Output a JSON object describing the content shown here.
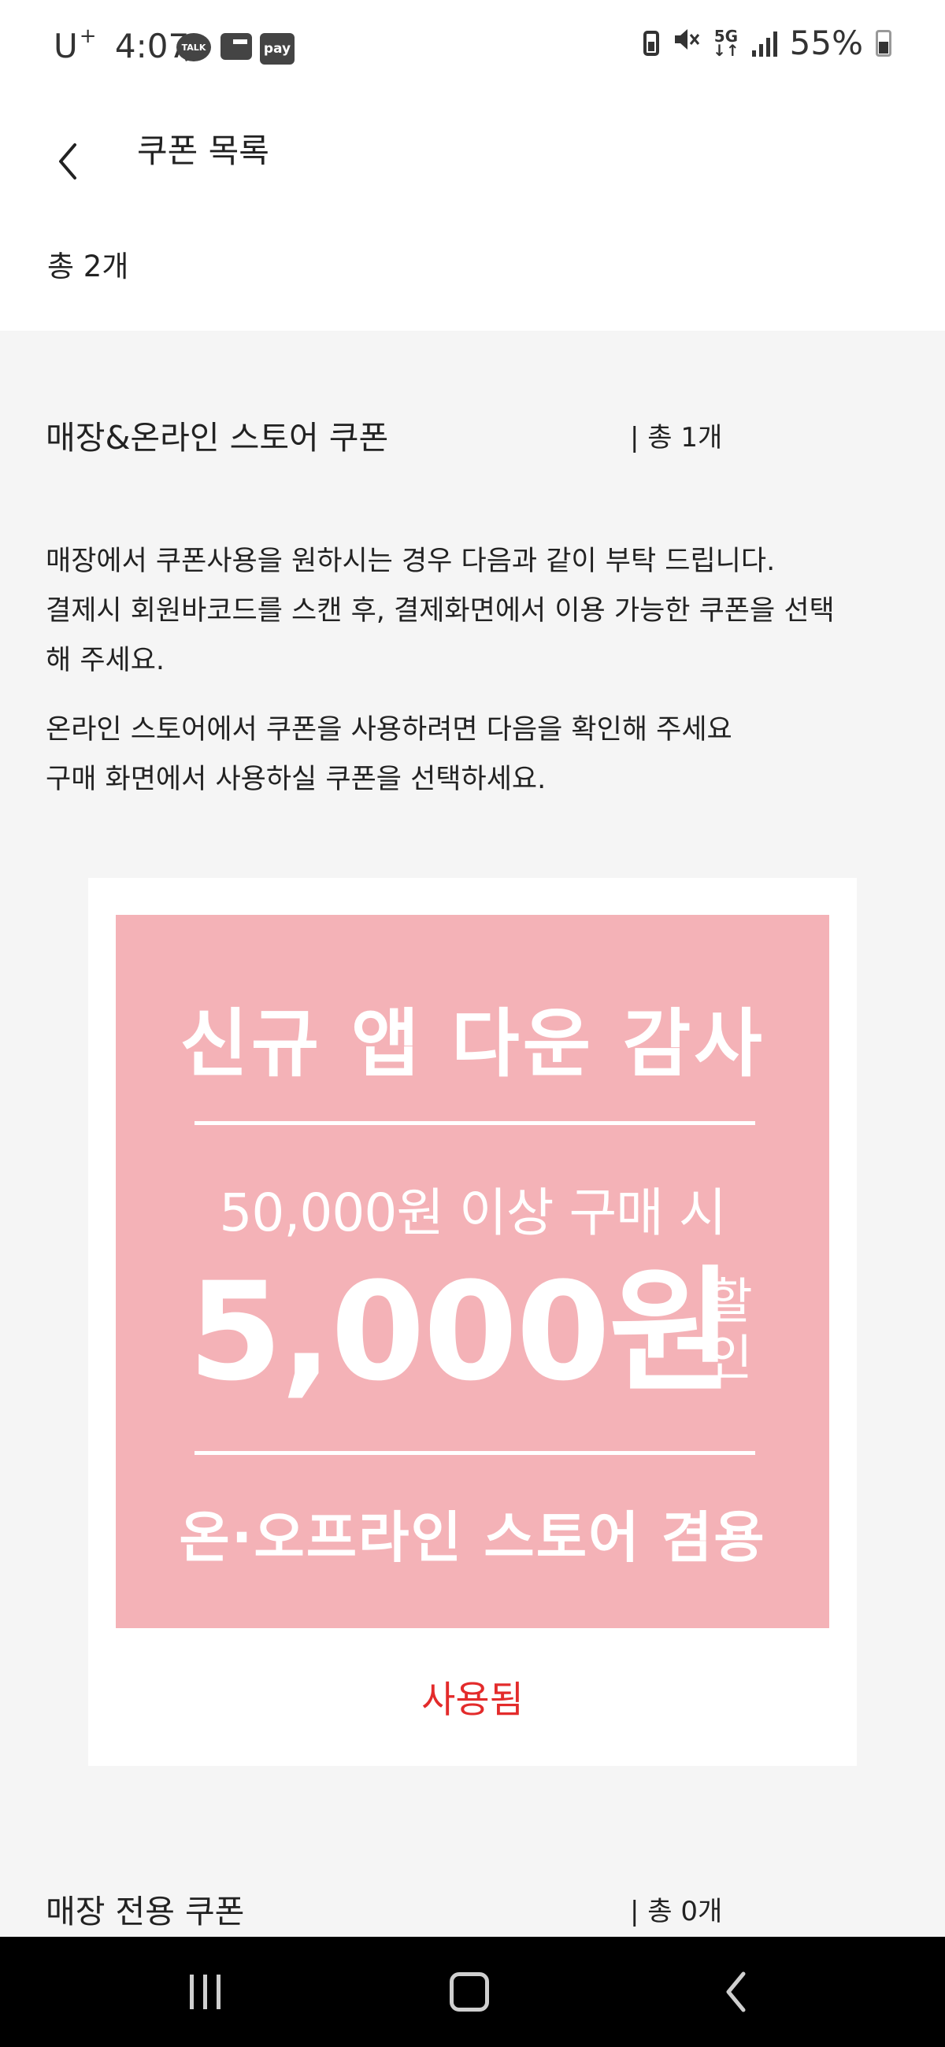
{
  "status_bar": {
    "carrier": "U",
    "carrier_sup": "+",
    "time": "4:07",
    "talk_label": "TALK",
    "pay_label": "pay",
    "network_label": "5G",
    "battery_percent": "55%",
    "battery_level": 0.55
  },
  "header": {
    "title": "쿠폰 목록",
    "total_count": "총 2개"
  },
  "sections": [
    {
      "title": "매장&온라인 스토어 쿠폰",
      "count": "| 총 1개",
      "info_lines": [
        "매장에서 쿠폰사용을 원하시는 경우 다음과 같이 부탁 드립니다.",
        "결제시 회원바코드를 스캔 후, 결제화면에서 이용 가능한 쿠폰을 선택",
        "해 주세요."
      ],
      "info_lines_2": [
        "온라인 스토어에서 쿠폰을 사용하려면 다음을 확인해 주세요",
        "구매 화면에서 사용하실 쿠폰을 선택하세요."
      ]
    },
    {
      "title": "매장 전용 쿠폰",
      "count": "| 총 0개"
    }
  ],
  "coupon": {
    "headline": "신규 앱 다운 감사",
    "condition": "50,000원 이상 구매 시",
    "amount": "5,000원",
    "amount_suffix": "할인",
    "usage": "온·오프라인 스토어 겸용",
    "status": "사용됨",
    "bg_color": "#f4b2b7",
    "status_color": "#e32b2b"
  }
}
